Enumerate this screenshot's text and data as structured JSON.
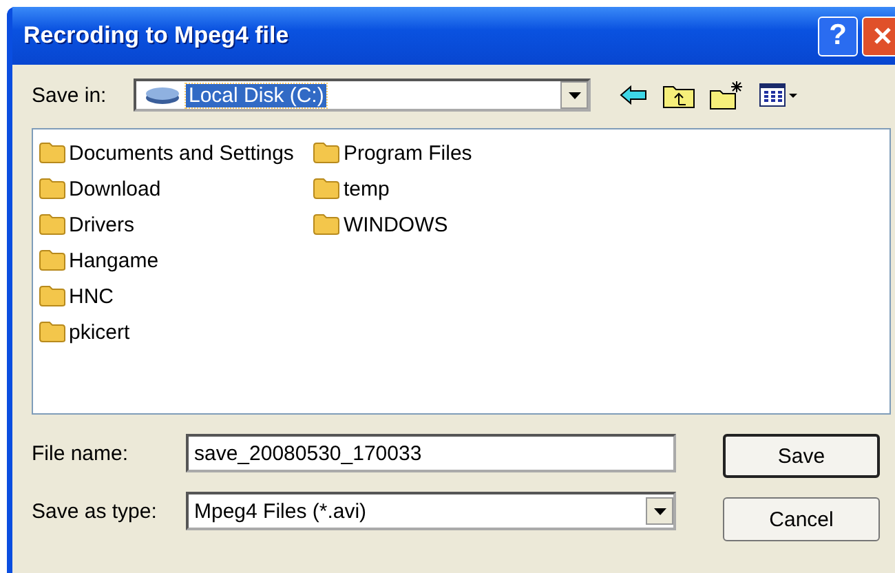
{
  "window": {
    "title": "Recroding to Mpeg4 file",
    "help": "?"
  },
  "save_in": {
    "label": "Save in:",
    "value": "Local Disk (C:)",
    "focused": true
  },
  "folders": [
    {
      "name": "Documents and Settings"
    },
    {
      "name": "Download"
    },
    {
      "name": "Drivers"
    },
    {
      "name": "Hangame"
    },
    {
      "name": "HNC"
    },
    {
      "name": "pkicert"
    },
    {
      "name": "Program Files"
    },
    {
      "name": "temp"
    },
    {
      "name": "WINDOWS"
    }
  ],
  "file_name": {
    "label": "File name:",
    "value": "save_20080530_170033"
  },
  "save_as_type": {
    "label": "Save as type:",
    "value": "Mpeg4 Files (*.avi)"
  },
  "buttons": [
    {
      "label": "Save",
      "kind": "default"
    },
    {
      "label": "Cancel",
      "kind": "normal"
    }
  ]
}
